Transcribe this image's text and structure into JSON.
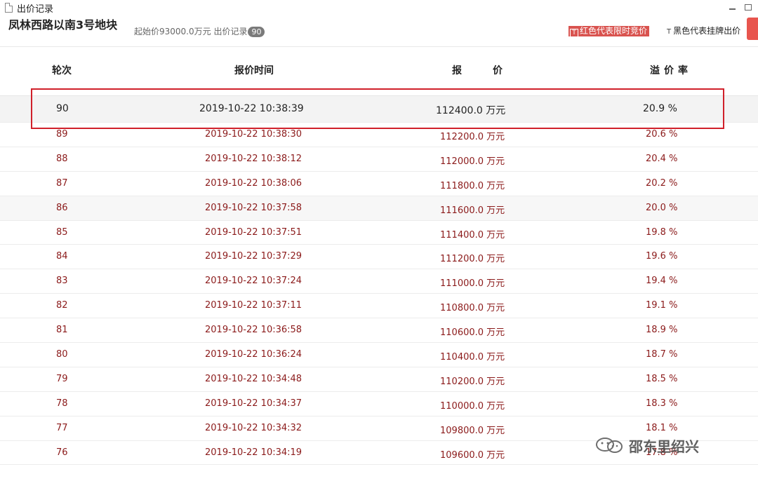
{
  "window": {
    "title": "出价记录"
  },
  "header": {
    "lot_name": "凤林西路以南3号地块",
    "start_price_text": "起始价93000.0万元 出价记录",
    "bid_count": "90",
    "legend_red": "红色代表限时竞价",
    "legend_black": "黑色代表挂牌出价",
    "legend_icon_letter": "T"
  },
  "table": {
    "headers": {
      "round": "轮次",
      "time": "报价时间",
      "price_a": "报",
      "price_b": "价",
      "rate_a": "溢",
      "rate_b": "价",
      "rate_c": "率"
    },
    "rows": [
      {
        "round": "90",
        "time": "2019-10-22 10:38:39",
        "price": "112400.0 万元",
        "rate": "20.9 %"
      },
      {
        "round": "89",
        "time": "2019-10-22 10:38:30",
        "price": "112200.0 万元",
        "rate": "20.6 %"
      },
      {
        "round": "88",
        "time": "2019-10-22 10:38:12",
        "price": "112000.0 万元",
        "rate": "20.4 %"
      },
      {
        "round": "87",
        "time": "2019-10-22 10:38:06",
        "price": "111800.0 万元",
        "rate": "20.2 %"
      },
      {
        "round": "86",
        "time": "2019-10-22 10:37:58",
        "price": "111600.0 万元",
        "rate": "20.0 %"
      },
      {
        "round": "85",
        "time": "2019-10-22 10:37:51",
        "price": "111400.0 万元",
        "rate": "19.8 %"
      },
      {
        "round": "84",
        "time": "2019-10-22 10:37:29",
        "price": "111200.0 万元",
        "rate": "19.6 %"
      },
      {
        "round": "83",
        "time": "2019-10-22 10:37:24",
        "price": "111000.0 万元",
        "rate": "19.4 %"
      },
      {
        "round": "82",
        "time": "2019-10-22 10:37:11",
        "price": "110800.0 万元",
        "rate": "19.1 %"
      },
      {
        "round": "81",
        "time": "2019-10-22 10:36:58",
        "price": "110600.0 万元",
        "rate": "18.9 %"
      },
      {
        "round": "80",
        "time": "2019-10-22 10:36:24",
        "price": "110400.0 万元",
        "rate": "18.7 %"
      },
      {
        "round": "79",
        "time": "2019-10-22 10:34:48",
        "price": "110200.0 万元",
        "rate": "18.5 %"
      },
      {
        "round": "78",
        "time": "2019-10-22 10:34:37",
        "price": "110000.0 万元",
        "rate": "18.3 %"
      },
      {
        "round": "77",
        "time": "2019-10-22 10:34:32",
        "price": "109800.0 万元",
        "rate": "18.1 %"
      },
      {
        "round": "76",
        "time": "2019-10-22 10:34:19",
        "price": "109600.0 万元",
        "rate": "17.8 %"
      }
    ]
  },
  "watermark": {
    "text": "邵东里绍兴"
  },
  "colors": {
    "highlight": "#d0202a",
    "limited_bid_red": "#d9534f",
    "row_text": "#8b1a1a"
  }
}
